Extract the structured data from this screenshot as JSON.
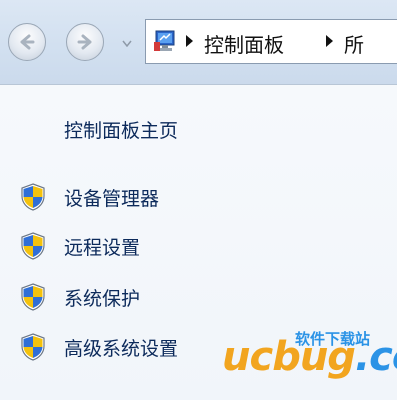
{
  "nav": {
    "back_icon": "back-arrow-icon",
    "forward_icon": "forward-arrow-icon",
    "recent_icon": "chevron-down-icon"
  },
  "address": {
    "icon": "control-panel-icon",
    "crumbs": [
      "控制面板",
      "所"
    ]
  },
  "pane": {
    "home_link": "控制面板主页",
    "tasks": [
      {
        "label": "设备管理器",
        "icon": "uac-shield-icon"
      },
      {
        "label": "远程设置",
        "icon": "uac-shield-icon"
      },
      {
        "label": "系统保护",
        "icon": "uac-shield-icon"
      },
      {
        "label": "高级系统设置",
        "icon": "uac-shield-icon"
      }
    ]
  },
  "watermark": {
    "brand": "ucbug",
    "domain": ".cc",
    "tagline": "软件下载站"
  },
  "colors": {
    "link": "#0c2a5b",
    "watermark_blue": "#2b93e6",
    "watermark_orange": "#f2a51f"
  }
}
